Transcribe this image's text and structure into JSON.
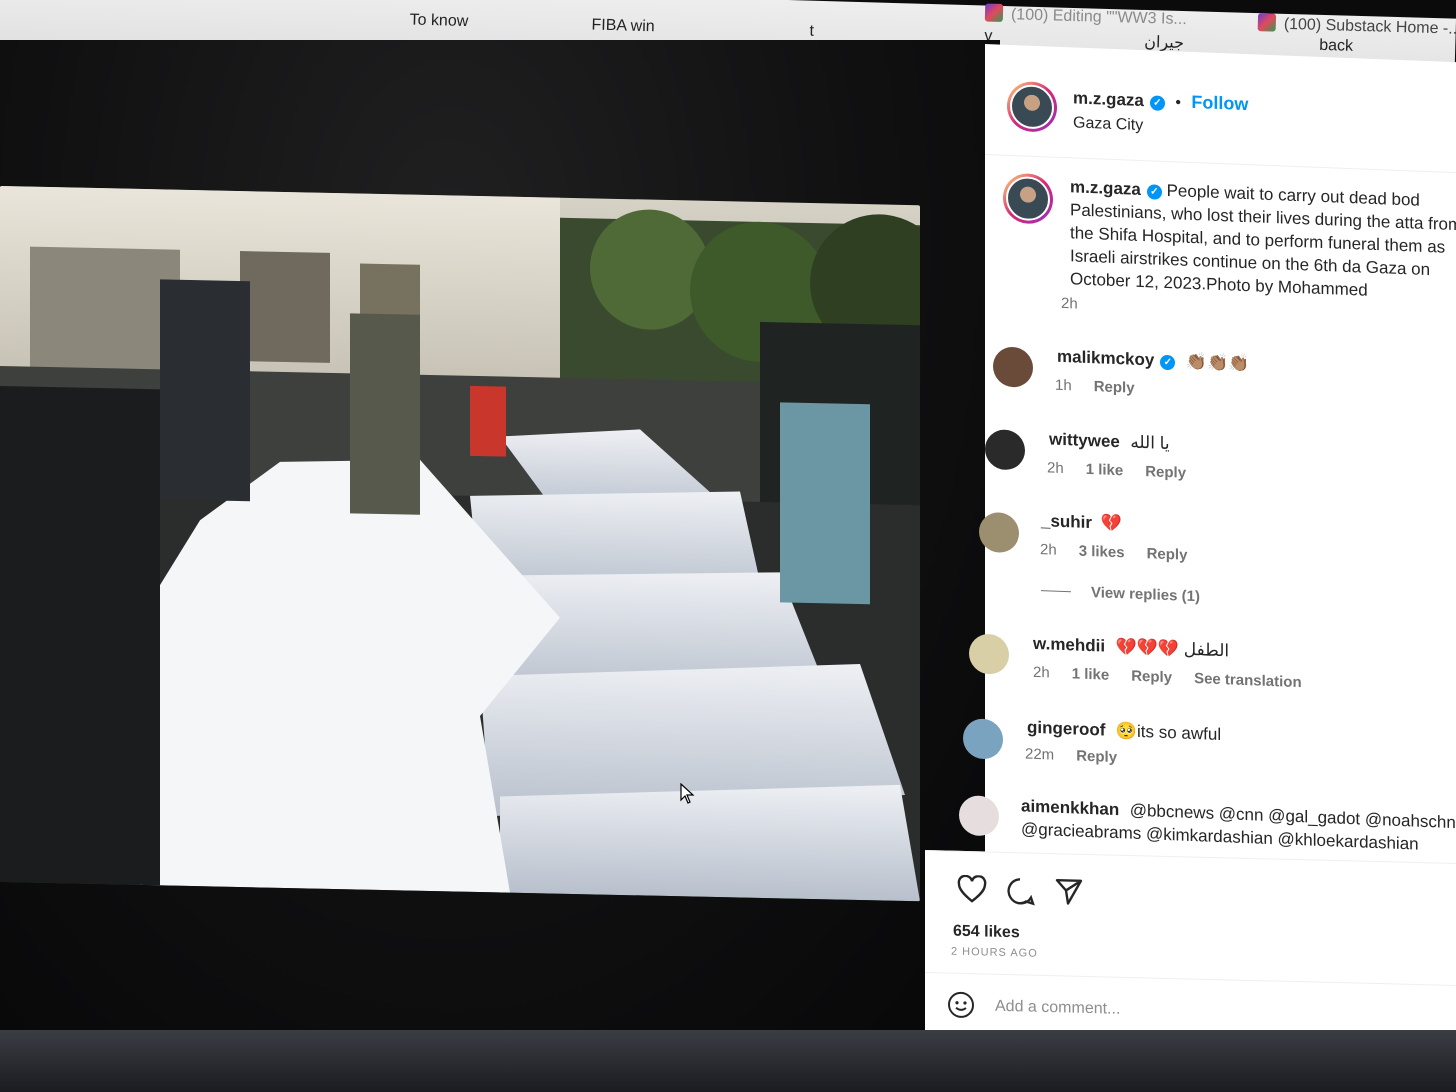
{
  "bookmarks": [
    {
      "label": "To know"
    },
    {
      "label": "FIBA win"
    },
    {
      "label": "t"
    },
    {
      "label": "v"
    },
    {
      "label": "جيران"
    },
    {
      "label": "back"
    },
    {
      "label": "(100) Editing \"\"WW3 Is..."
    },
    {
      "label": "(100) Substack Home -..."
    }
  ],
  "post": {
    "username": "m.z.gaza",
    "follow_label": "Follow",
    "location": "Gaza City",
    "caption": "People wait to carry out dead bod Palestinians, who lost their lives during the atta from the Shifa Hospital, and to perform funeral them as Israeli airstrikes continue on the 6th da Gaza on October 12, 2023.Photo by Mohammed",
    "caption_time": "2h",
    "likes": "654 likes",
    "time_ago": "2 HOURS AGO",
    "add_comment_placeholder": "Add a comment..."
  },
  "comments": [
    {
      "username": "malikmckoy",
      "verified": true,
      "text": "👏🏽👏🏽👏🏽",
      "time": "1h",
      "likes": "",
      "reply": "Reply",
      "translation": ""
    },
    {
      "username": "wittywee",
      "verified": false,
      "text": "يا الله",
      "time": "2h",
      "likes": "1 like",
      "reply": "Reply",
      "translation": ""
    },
    {
      "username": "_suhir",
      "verified": false,
      "text": "💔",
      "time": "2h",
      "likes": "3 likes",
      "reply": "Reply",
      "translation": ""
    },
    {
      "username": "w.mehdii",
      "verified": false,
      "text": "💔💔💔 الطفل",
      "time": "2h",
      "likes": "1 like",
      "reply": "Reply",
      "translation": "See translation"
    },
    {
      "username": "gingeroof",
      "verified": false,
      "text": "🥺its so awful",
      "time": "22m",
      "likes": "",
      "reply": "Reply",
      "translation": ""
    },
    {
      "username": "aimenkkhan",
      "verified": false,
      "text": "@bbcnews @cnn @gal_gadot @noahschna @gracieabrams @kimkardashian @khloekardashian",
      "time": "",
      "likes": "",
      "reply": "",
      "translation": ""
    }
  ],
  "view_replies": "View replies (1)",
  "icons": {
    "like": "heart-icon",
    "comment": "comment-icon",
    "share": "share-icon",
    "emoji": "emoji-icon"
  },
  "colors": {
    "accent": "#0095f6",
    "text": "#262626",
    "muted": "#737373"
  }
}
